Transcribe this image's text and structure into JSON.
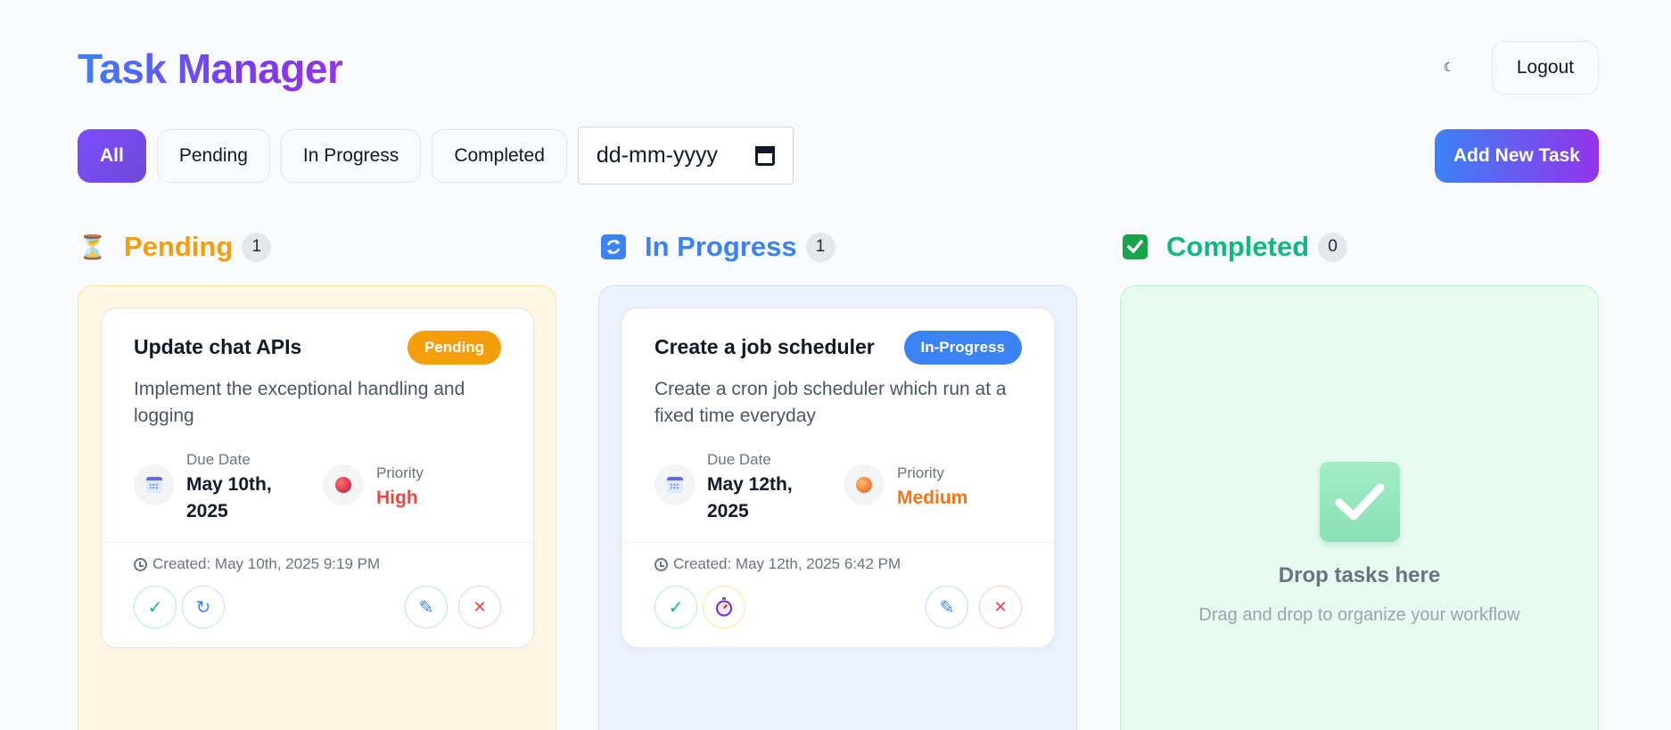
{
  "header": {
    "title": "Task Manager",
    "theme_icon": "moon-icon",
    "logout_label": "Logout"
  },
  "filters": {
    "items": [
      "All",
      "Pending",
      "In Progress",
      "Completed"
    ],
    "active": "All",
    "date_placeholder": "dd-mm-yyyy"
  },
  "add_task_label": "Add New Task",
  "columns": {
    "pending": {
      "icon": "hourglass-icon",
      "title": "Pending",
      "count": "1"
    },
    "in_progress": {
      "icon": "arrows-counterclockwise-icon",
      "title": "In Progress",
      "count": "1"
    },
    "completed": {
      "icon": "check-box-icon",
      "title": "Completed",
      "count": "0"
    }
  },
  "tasks": [
    {
      "title": "Update chat APIs",
      "status": "Pending",
      "description": "Implement the exceptional handling and logging",
      "due_label": "Due Date",
      "due_line1": "May 10th,",
      "due_line2": "2025",
      "priority_label": "Priority",
      "priority": "High",
      "created": "Created: May 10th, 2025 9:19 PM"
    },
    {
      "title": "Create a job scheduler",
      "status": "In-Progress",
      "description": "Create a cron job scheduler which run at a fixed time everyday",
      "due_label": "Due Date",
      "due_line1": "May 12th,",
      "due_line2": "2025",
      "priority_label": "Priority",
      "priority": "Medium",
      "created": "Created: May 12th, 2025 6:42 PM"
    }
  ],
  "drop_zone": {
    "title": "Drop tasks here",
    "subtitle": "Drag and drop to organize your workflow"
  },
  "colors": {
    "pending": "#f59e0b",
    "in_progress": "#3b82f6",
    "completed": "#10b981",
    "accent": "#7c3aed"
  }
}
